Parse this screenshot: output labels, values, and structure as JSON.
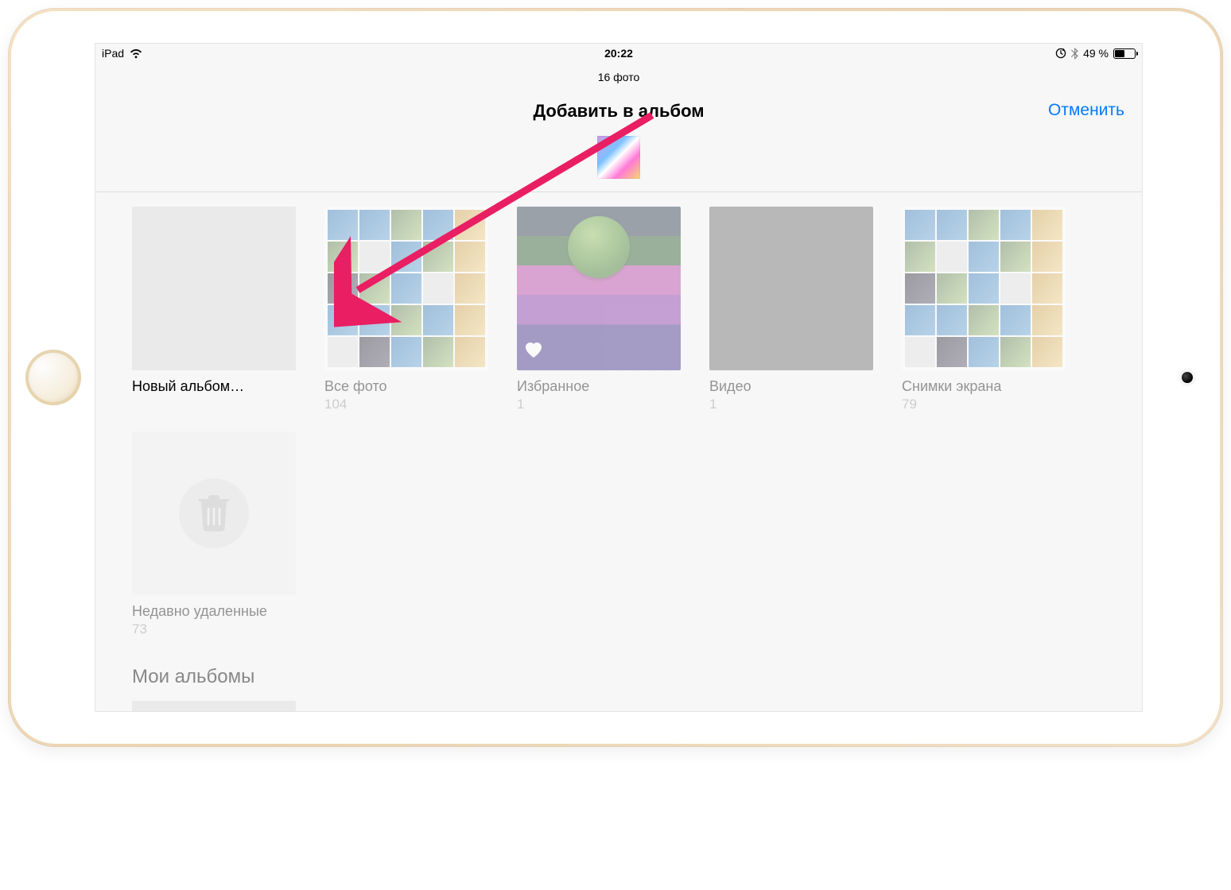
{
  "status_bar": {
    "device": "iPad",
    "time": "20:22",
    "battery_pct": "49 %"
  },
  "header": {
    "subtitle": "16 фото",
    "title": "Добавить в альбом",
    "cancel": "Отменить"
  },
  "albums_row1": [
    {
      "label": "Новый альбом…",
      "count": ""
    },
    {
      "label": "Все фото",
      "count": "104"
    },
    {
      "label": "Избранное",
      "count": "1"
    },
    {
      "label": "Видео",
      "count": "1"
    },
    {
      "label": "Снимки экрана",
      "count": "79"
    }
  ],
  "albums_row2": [
    {
      "label": "Недавно удаленные",
      "count": "73"
    }
  ],
  "section_my_albums": "Мои альбомы",
  "colors": {
    "accent": "#007aff"
  }
}
